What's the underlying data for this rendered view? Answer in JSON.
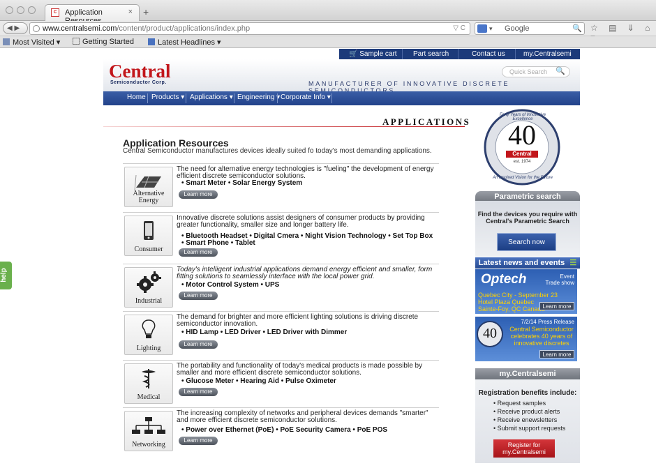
{
  "browser": {
    "tab_title": "Application Resources",
    "tab_close": "×",
    "new_tab": "+",
    "back_forward": "◀ ▶",
    "url_host": "www.centralsemi.com",
    "url_path": "/content/product/applications/index.php",
    "url_right": "▽ C",
    "search_engine": "Google",
    "search_icon": "🔍",
    "bookmarks": [
      "Most Visited ▾",
      "Getting Started",
      "Latest Headlines ▾"
    ]
  },
  "topbar": {
    "items": [
      "Sample cart",
      "Part search",
      "Contact us",
      "my.Centralsemi"
    ]
  },
  "header": {
    "logo": "Central",
    "logo_sub": "Semiconductor Corp.",
    "tagline": "Manufacturer of Innovative Discrete Semiconductors",
    "quick_search_placeholder": "Quick Search"
  },
  "nav": {
    "items": [
      "Home",
      "Products ▾",
      "Applications ▾",
      "Engineering ▾",
      "Corporate Info ▾"
    ]
  },
  "page": {
    "heading": "Applications",
    "title": "Application Resources",
    "subtitle": "Central Semiconductor manufactures devices ideally suited fo today's most demanding applications.",
    "learn_more": "Learn more"
  },
  "apps": [
    {
      "name": "Alternative Energy",
      "icon": "solar-panel-icon",
      "desc": "The need for alternative energy technologies is \"fueling\" the development of energy efficient discrete semiconductor solutions.",
      "bullets": [
        "• Smart Meter   • Solar Energy System"
      ]
    },
    {
      "name": "Consumer",
      "icon": "smartphone-icon",
      "desc": "Innovative discrete solutions assist designers of consumer products by providing greater functionality, smaller size and longer battery life.",
      "bullets": [
        "• Bluetooth Headset   • Digital Cmera   • Night Vision Technology   • Set Top Box",
        "• Smart Phone   • Tablet"
      ]
    },
    {
      "name": "Industrial",
      "icon": "gears-icon",
      "desc": "Today's intelligent industrial applications demand energy efficient and smaller, form fitting solutions to seamlessly interface with the local power grid.",
      "bullets": [
        "• Motor Control System   • UPS"
      ]
    },
    {
      "name": "Lighting",
      "icon": "lightbulb-icon",
      "desc": "The demand for brighter and more efficient lighting solutions is driving discrete semiconductor innovation.",
      "bullets": [
        "• HID Lamp   • LED Driver   • LED Driver with Dimmer"
      ]
    },
    {
      "name": "Medical",
      "icon": "caduceus-icon",
      "desc": "The portability and functionality of today's medical products is made possible by smaller and more efficient discrete semiconductor solutions.",
      "bullets": [
        "• Glucose Meter   • Hearing Aid   • Pulse Oximeter"
      ]
    },
    {
      "name": "Networking",
      "icon": "network-icon",
      "desc": "The increasing complexity of networks and peripheral devices demands \"smarter\" and more efficient discrete semiconductor solutions.",
      "bullets": [
        "• Power over Ethernet (PoE)   • PoE Security Camera   • PoE POS"
      ]
    }
  ],
  "sidebar": {
    "badge_number": "40",
    "badge_top_text": "Forty Years of Innovative Excellence",
    "badge_bottom_text": "An Inspired Vision for the Future",
    "badge_logo": "Central",
    "badge_est": "est. 1974",
    "parametric_title": "Parametric search",
    "parametric_text": "Find the devices you require with Central's Parametric Search",
    "search_now": "Search now",
    "news_title": "Latest news and events",
    "event_logo": "Optech",
    "event_type": "Event\nTrade show",
    "event_text": "Quebec City - September 23\nHotel Plaza Quebec\nSainte-Foy, QC Canada",
    "learn_more": "Learn more",
    "press_date": "7/2/14 Press Release",
    "press_text": "Central Semiconductor celebrates 40 years of innovative discretes",
    "my_title": "my.Centralsemi",
    "reg_title": "Registration benefits include:",
    "reg_items": [
      "• Request samples",
      "• Receive product alerts",
      "• Receive enewsletters",
      "• Submit support requests"
    ],
    "register_label": "Register for my.Centralsemi"
  },
  "help": "help"
}
